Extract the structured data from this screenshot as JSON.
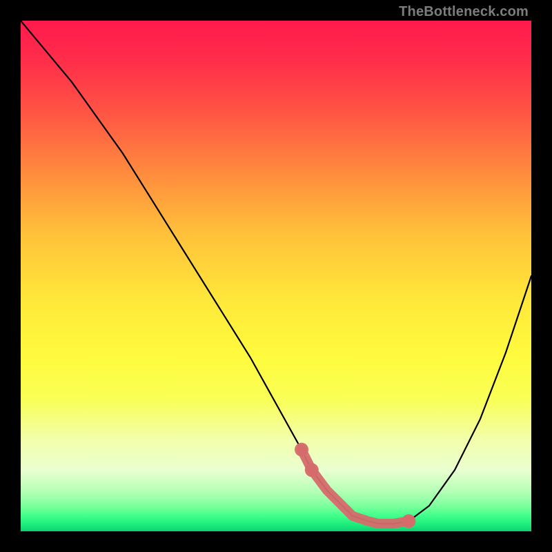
{
  "watermark": "TheBottleneck.com",
  "chart_data": {
    "type": "line",
    "title": "",
    "xlabel": "",
    "ylabel": "",
    "xlim": [
      0,
      100
    ],
    "ylim": [
      0,
      100
    ],
    "grid": false,
    "legend": false,
    "annotations": [],
    "series": [
      {
        "name": "bottleneck-curve",
        "stroke": "#000000",
        "style": "solid",
        "x": [
          0,
          5,
          10,
          15,
          20,
          25,
          30,
          35,
          40,
          45,
          50,
          55,
          57,
          60,
          63,
          65,
          68,
          70,
          73,
          76,
          80,
          85,
          90,
          95,
          100
        ],
        "y": [
          100,
          94,
          88,
          81,
          74,
          66,
          58,
          50,
          42,
          34,
          25,
          16,
          12,
          8,
          5,
          3,
          2,
          1.5,
          1.5,
          2,
          5,
          12,
          22,
          35,
          50
        ]
      },
      {
        "name": "highlight-band",
        "stroke": "#d56b6b",
        "style": "thick",
        "x": [
          55,
          57,
          60,
          63,
          65,
          68,
          70,
          73,
          76
        ],
        "y": [
          16,
          12,
          8,
          5,
          3,
          2,
          1.5,
          1.5,
          2
        ]
      }
    ],
    "markers": [
      {
        "series": "highlight-band",
        "x": 55,
        "y": 16
      },
      {
        "series": "highlight-band",
        "x": 57,
        "y": 12
      },
      {
        "series": "highlight-band",
        "x": 76,
        "y": 2
      }
    ],
    "gradient_stops": [
      {
        "pct": 0,
        "color": "#ff1a4d"
      },
      {
        "pct": 8,
        "color": "#ff2e4a"
      },
      {
        "pct": 18,
        "color": "#ff5544"
      },
      {
        "pct": 30,
        "color": "#ff8c3e"
      },
      {
        "pct": 42,
        "color": "#ffc23a"
      },
      {
        "pct": 55,
        "color": "#ffe83a"
      },
      {
        "pct": 66,
        "color": "#fffb3e"
      },
      {
        "pct": 74,
        "color": "#f9ff55"
      },
      {
        "pct": 82,
        "color": "#f2ffaa"
      },
      {
        "pct": 88,
        "color": "#eaffd0"
      },
      {
        "pct": 92,
        "color": "#b7ffb7"
      },
      {
        "pct": 95,
        "color": "#7dff9e"
      },
      {
        "pct": 97,
        "color": "#3fff8a"
      },
      {
        "pct": 99,
        "color": "#17e87a"
      },
      {
        "pct": 100,
        "color": "#0fcf70"
      }
    ]
  }
}
